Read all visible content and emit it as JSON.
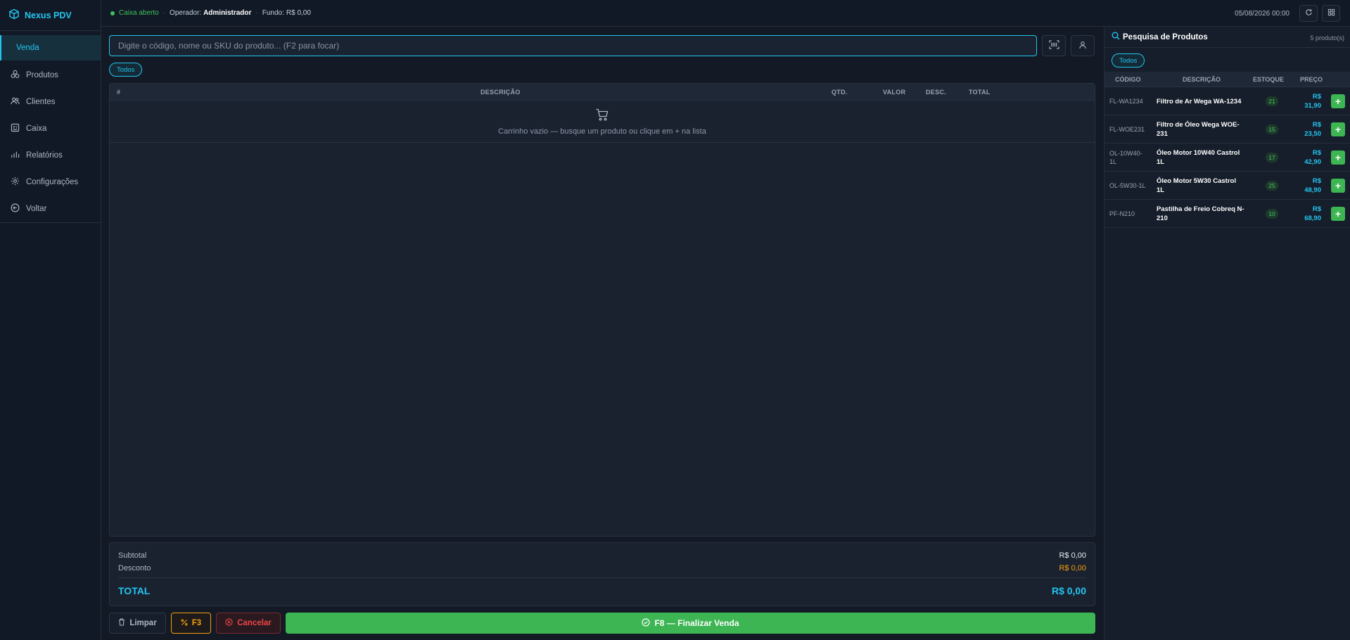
{
  "app": {
    "name": "Nexus PDV"
  },
  "sidebar": {
    "items": [
      {
        "label": "Venda",
        "icon": "none",
        "active": true
      },
      {
        "label": "Produtos",
        "icon": "boxes-icon"
      },
      {
        "label": "Clientes",
        "icon": "users-icon"
      },
      {
        "label": "Caixa",
        "icon": "register-icon"
      },
      {
        "label": "Relatórios",
        "icon": "bar-chart-icon"
      },
      {
        "label": "Configurações",
        "icon": "gear-icon"
      },
      {
        "label": "Voltar",
        "icon": "arrow-left-circle-icon"
      }
    ]
  },
  "topbar": {
    "status": "Caixa aberto",
    "operator_label": "Operador:",
    "operator_name": "Administrador",
    "fund_label": "Fundo:",
    "fund_value": "R$ 0,00",
    "datetime": "05/08/2026 00:00"
  },
  "search": {
    "placeholder": "Digite o código, nome ou SKU do produto... (F2 para focar)",
    "filter_chip": "Todos"
  },
  "cart": {
    "columns": [
      "#",
      "DESCRIÇÃO",
      "QTD.",
      "VALOR",
      "DESC.",
      "TOTAL"
    ],
    "empty_message": "Carrinho vazio — busque um produto ou clique em + na lista"
  },
  "totals": {
    "subtotal_label": "Subtotal",
    "subtotal_value": "R$ 0,00",
    "discount_label": "Desconto",
    "discount_value": "R$ 0,00",
    "total_label": "TOTAL",
    "total_value": "R$ 0,00"
  },
  "actions": {
    "clear": "Limpar",
    "discount": "F3",
    "cancel": "Cancelar",
    "finalize": "F8 — Finalizar Venda"
  },
  "product_panel": {
    "title": "Pesquisa de Produtos",
    "count": "5 produto(s)",
    "filter_chip": "Todos",
    "columns": [
      "CÓDIGO",
      "DESCRIÇÃO",
      "ESTOQUE",
      "PREÇO"
    ],
    "rows": [
      {
        "code": "FL-WA1234",
        "description": "Filtro de Ar Wega WA-1234",
        "stock": "21",
        "price": "R$ 31,90"
      },
      {
        "code": "FL-WOE231",
        "description": "Filtro de Óleo Wega WOE-231",
        "stock": "15",
        "price": "R$ 23,50"
      },
      {
        "code": "OL-10W40-1L",
        "description": "Óleo Motor 10W40 Castrol 1L",
        "stock": "17",
        "price": "R$ 42,90"
      },
      {
        "code": "OL-5W30-1L",
        "description": "Óleo Motor 5W30 Castrol 1L",
        "stock": "25",
        "price": "R$ 48,90"
      },
      {
        "code": "PF-N210",
        "description": "Pastilha de Freio Cobreq N-210",
        "stock": "10",
        "price": "R$ 68,90"
      }
    ],
    "add_label": "+"
  },
  "colors": {
    "accent": "#22c6f0",
    "success": "#3db553",
    "warning": "#f59e0b",
    "danger": "#ef4444",
    "background": "#131a26"
  }
}
